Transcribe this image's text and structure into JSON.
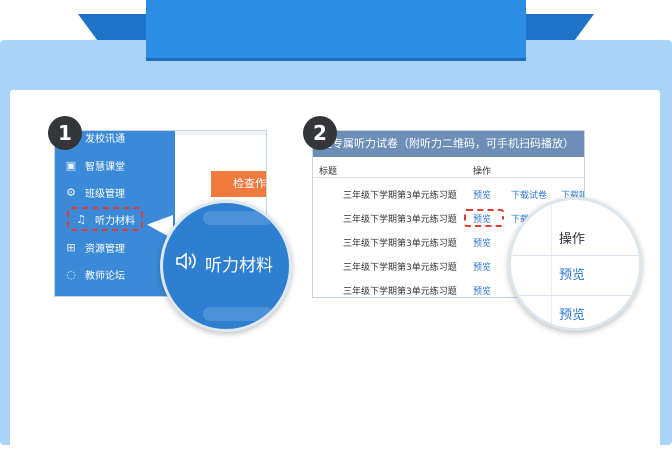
{
  "steps": [
    "1",
    "2"
  ],
  "sidebar": {
    "items": [
      {
        "label": "发校讯通",
        "icon": "message-icon"
      },
      {
        "label": "智慧课堂",
        "icon": "classroom-icon"
      },
      {
        "label": "班级管理",
        "icon": "gear-icon"
      },
      {
        "label": "听力材料",
        "icon": "speaker-icon"
      },
      {
        "label": "资源管理",
        "icon": "grid-icon"
      },
      {
        "label": "教师论坛",
        "icon": "chat-icon"
      }
    ]
  },
  "check_button": "检查作",
  "zoom_left": {
    "label": "听力材料"
  },
  "table": {
    "title": "区专属听力试卷（附听力二维码，可手机扫码播放）",
    "headers": {
      "title": "标题",
      "action": "操作"
    },
    "rows": [
      {
        "name": "三年级下学期第3单元练习题",
        "preview": "预览",
        "download1": "下载试卷",
        "download2": "下载听"
      },
      {
        "name": "三年级下学期第3单元练习题",
        "preview": "预览",
        "download1": "下载试",
        "download2": ""
      },
      {
        "name": "三年级下学期第3单元练习题",
        "preview": "预览",
        "download1": "",
        "download2": ""
      },
      {
        "name": "三年级下学期第3单元练习题",
        "preview": "预览",
        "download1": "",
        "download2": ""
      },
      {
        "name": "三年级下学期第3单元练习题",
        "preview": "预览",
        "download1": "",
        "download2": ""
      }
    ]
  },
  "zoom_right": {
    "action": "操作",
    "preview1": "预览",
    "preview2": "预览"
  }
}
